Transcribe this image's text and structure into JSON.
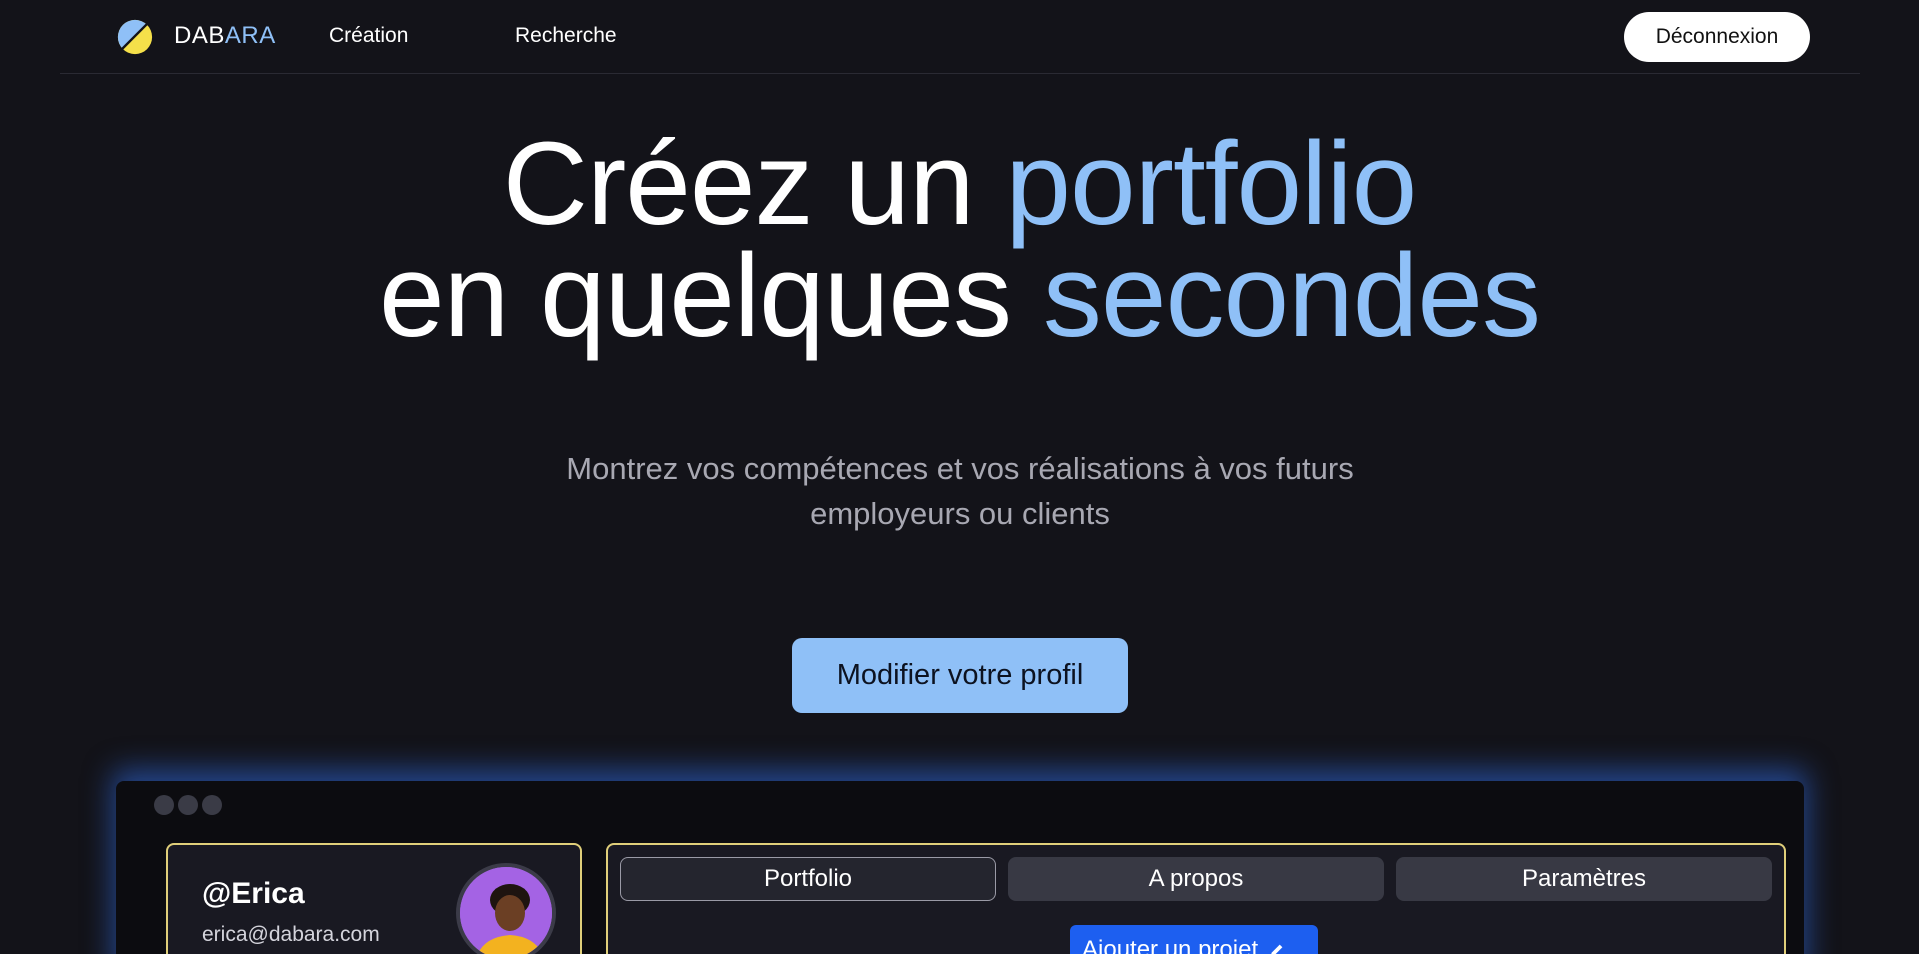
{
  "nav": {
    "brand_part1": "DAB",
    "brand_part2": "ARA",
    "links": [
      {
        "label": "Création"
      },
      {
        "label": "Recherche"
      }
    ],
    "logout_label": "Déconnexion"
  },
  "hero": {
    "line1_white": "Créez un",
    "line1_accent": "portfolio",
    "line2_white": "en quelques",
    "line2_accent": "secondes",
    "subtitle": "Montrez vos compétences et vos réalisations à vos futurs employeurs ou clients",
    "cta_label": "Modifier votre profil"
  },
  "preview": {
    "handle": "@Erica",
    "email": "erica@dabara.com",
    "tabs": [
      {
        "label": "Portfolio",
        "active": true
      },
      {
        "label": "A propos",
        "active": false
      },
      {
        "label": "Paramètres",
        "active": false
      }
    ],
    "add_project_label": "Ajouter un projet"
  },
  "colors": {
    "background": "#131319",
    "accent": "#8fc0f7",
    "card_border": "#e0cf7a",
    "add_button": "#1d5ff0",
    "logo_blue": "#8fc0f7",
    "logo_yellow": "#f5e04a"
  },
  "icons": {
    "logo": "dabara-logo-icon",
    "edit": "pencil-icon",
    "avatar": "user-avatar"
  }
}
